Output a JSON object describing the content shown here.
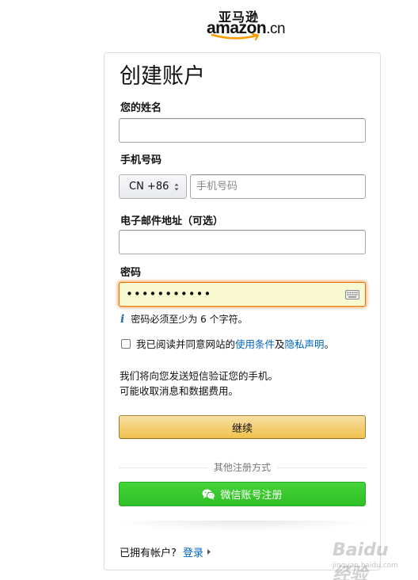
{
  "logo": {
    "chinese": "亚马逊",
    "word": "amazon",
    "domain": ".cn"
  },
  "form": {
    "title": "创建账户",
    "name_label": "您的姓名",
    "name_value": "",
    "phone_label": "手机号码",
    "country_code": "CN +86",
    "phone_placeholder": "手机号码",
    "email_label": "电子邮件地址（可选）",
    "email_value": "",
    "password_label": "密码",
    "password_value": "•••••••••••",
    "password_hint": "密码必须至少为 6 个字符。",
    "agree_prefix": "我已阅读并同意网站的",
    "agree_terms": "使用条件",
    "agree_and": "及",
    "agree_privacy": "隐私声明",
    "agree_suffix": "。",
    "sms_line1": "我们将向您发送短信验证您的手机。",
    "sms_line2": "可能收取消息和数据费用。",
    "continue_label": "继续",
    "other_methods": "其他注册方式",
    "wechat_label": "微信账号注册",
    "have_account": "已拥有帐户?",
    "signin_label": "登录"
  },
  "watermark": {
    "text": "Baidu 经验",
    "sub": "jingyan.baidu.com"
  },
  "colors": {
    "link": "#0066c0",
    "continue_bg": "#f0c14b",
    "wechat_bg": "#2fbf26",
    "focus": "#e77600",
    "password_bg": "#fafad2"
  }
}
